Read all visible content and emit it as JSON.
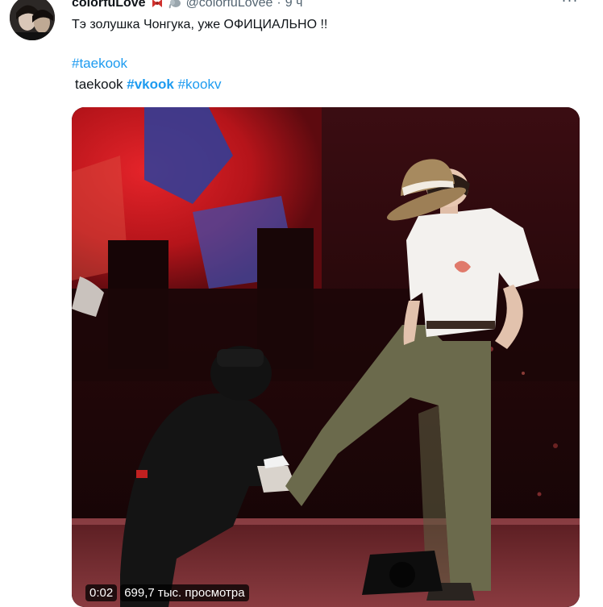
{
  "tweet": {
    "author_name": "colorfuLove",
    "author_handle": "@colorfuLovee",
    "separator": "·",
    "time": "9 ч",
    "more_label": "···",
    "text": "Тэ золушка Чонгука, уже ОФИЦИАЛЬНО !!",
    "hashtag_primary": "#taekook",
    "tags_plain": "taekook ",
    "hashtag_vkook": "#vkook",
    "hashtag_kookv": "#kookv"
  },
  "video": {
    "duration": "0:02",
    "views": "699,7 тыс. просмотра"
  },
  "icons": {
    "emoji_1": "bow-icon",
    "emoji_2": "elephant-icon",
    "more": "more-dots-icon"
  },
  "colors": {
    "link": "#1d9bf0",
    "secondary": "#536471",
    "stage_red": "#c4161c",
    "shirt": "#f3f1ee",
    "pants": "#6b6a4c"
  }
}
